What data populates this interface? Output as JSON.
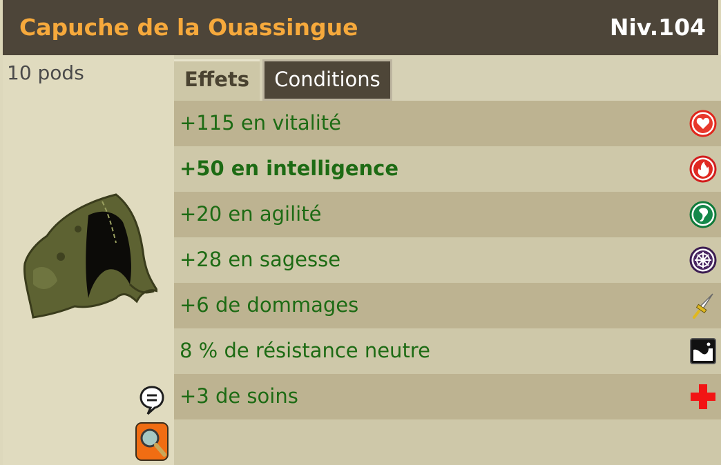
{
  "header": {
    "item_name": "Capuche de la Ouassingue",
    "level": "Niv.104"
  },
  "item": {
    "weight": "10 pods",
    "image": "olive-hood-icon"
  },
  "tabs": [
    {
      "label": "Effets",
      "active": true
    },
    {
      "label": "Conditions",
      "active": false
    }
  ],
  "effects": [
    {
      "text": "+115 en vitalité",
      "icon": "heart-icon",
      "bold": false
    },
    {
      "text": "+50 en intelligence",
      "icon": "fire-icon",
      "bold": true
    },
    {
      "text": "+20 en agilité",
      "icon": "air-icon",
      "bold": false
    },
    {
      "text": "+28 en sagesse",
      "icon": "wisdom-icon",
      "bold": false
    },
    {
      "text": "+6 de dommages",
      "icon": "sword-icon",
      "bold": false
    },
    {
      "text": "8 % de résistance neutre",
      "icon": "neutral-icon",
      "bold": false
    },
    {
      "text": "+3 de soins",
      "icon": "heal-cross-icon",
      "bold": false
    }
  ],
  "colors": {
    "title": "#f6a93c",
    "header_bg": "#4d4539",
    "effect_text": "#1d6b14"
  }
}
